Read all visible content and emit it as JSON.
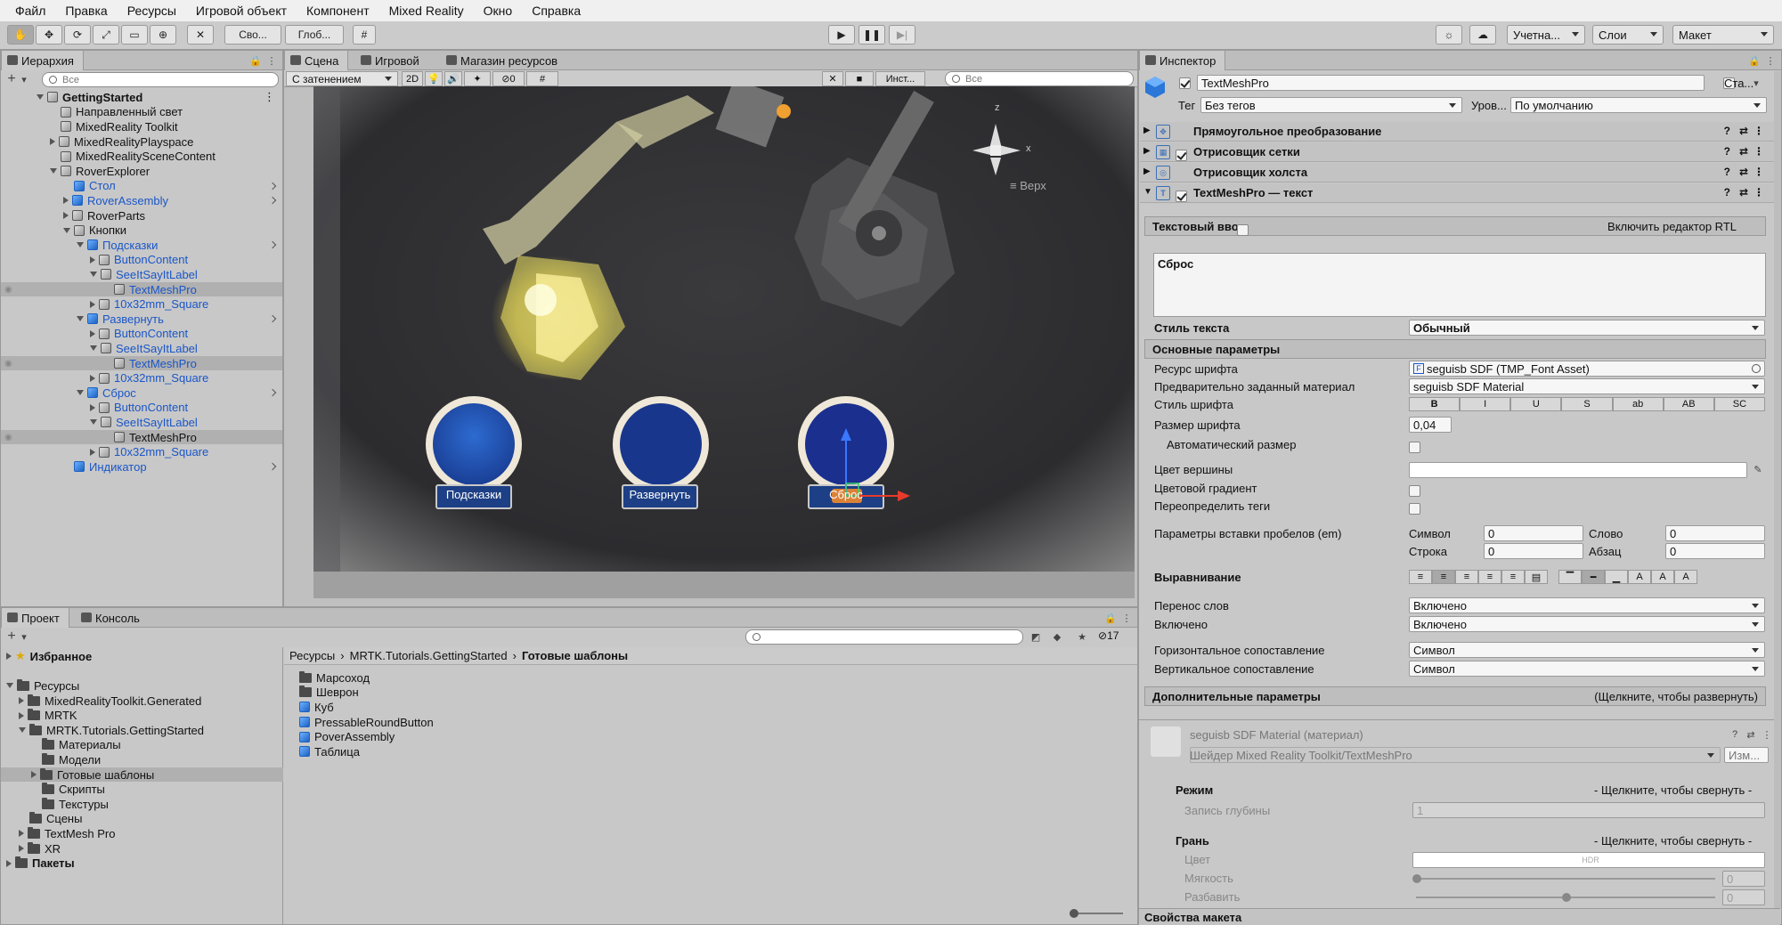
{
  "menu": [
    "Файл",
    "Правка",
    "Ресурсы",
    "Игровой объект",
    "Компонент",
    "Mixed Reality",
    "Окно",
    "Справка"
  ],
  "toolbar": {
    "pivot_label": "Сво...",
    "global_label": "Глоб...",
    "account_label": "Учетна...",
    "layers_label": "Слои",
    "layout_label": "Макет"
  },
  "hierarchy": {
    "tab": "Иерархия",
    "search_placeholder": "Все",
    "rows": [
      {
        "label": "GettingStarted",
        "indent": 0,
        "fold": "open",
        "icon": "unity",
        "bold": true,
        "sel": false,
        "blue": false,
        "chev": false
      },
      {
        "label": "Направленный свет",
        "indent": 1,
        "fold": "none",
        "icon": "cube",
        "sel": false,
        "blue": false,
        "chev": false
      },
      {
        "label": "MixedReality Toolkit",
        "indent": 1,
        "fold": "none",
        "icon": "cube",
        "sel": false,
        "blue": false,
        "chev": false
      },
      {
        "label": "MixedRealityPlayspace",
        "indent": 1,
        "fold": "closed",
        "icon": "cube",
        "sel": false,
        "blue": false,
        "chev": false
      },
      {
        "label": "MixedRealitySceneContent",
        "indent": 1,
        "fold": "none",
        "icon": "cube",
        "sel": false,
        "blue": false,
        "chev": false
      },
      {
        "label": "RoverExplorer",
        "indent": 1,
        "fold": "open",
        "icon": "cube",
        "sel": false,
        "blue": false,
        "chev": false
      },
      {
        "label": "Стол",
        "indent": 2,
        "fold": "none",
        "icon": "bluecube",
        "sel": false,
        "blue": true,
        "chev": true
      },
      {
        "label": "RoverAssembly",
        "indent": 2,
        "fold": "closed",
        "icon": "bluecube",
        "sel": false,
        "blue": true,
        "chev": true
      },
      {
        "label": "RoverParts",
        "indent": 2,
        "fold": "closed",
        "icon": "cube",
        "sel": false,
        "blue": false,
        "chev": false
      },
      {
        "label": "Кнопки",
        "indent": 2,
        "fold": "open",
        "icon": "cube",
        "sel": false,
        "blue": false,
        "chev": false
      },
      {
        "label": "Подсказки",
        "indent": 3,
        "fold": "open",
        "icon": "bluecube",
        "sel": false,
        "blue": true,
        "chev": true
      },
      {
        "label": "ButtonContent",
        "indent": 4,
        "fold": "closed",
        "icon": "cube",
        "sel": false,
        "blue": true,
        "chev": false
      },
      {
        "label": "SeeItSayItLabel",
        "indent": 4,
        "fold": "open",
        "icon": "cube",
        "sel": false,
        "blue": true,
        "chev": false
      },
      {
        "label": "TextMeshPro",
        "indent": 5,
        "fold": "none",
        "icon": "cube",
        "sel": true,
        "blue": true,
        "chev": false
      },
      {
        "label": "10x32mm_Square",
        "indent": 4,
        "fold": "closed",
        "icon": "cube",
        "sel": false,
        "blue": true,
        "chev": false
      },
      {
        "label": "Развернуть",
        "indent": 3,
        "fold": "open",
        "icon": "bluecube",
        "sel": false,
        "blue": true,
        "chev": true
      },
      {
        "label": "ButtonContent",
        "indent": 4,
        "fold": "closed",
        "icon": "cube",
        "sel": false,
        "blue": true,
        "chev": false
      },
      {
        "label": "SeeItSayItLabel",
        "indent": 4,
        "fold": "open",
        "icon": "cube",
        "sel": false,
        "blue": true,
        "chev": false
      },
      {
        "label": "TextMeshPro",
        "indent": 5,
        "fold": "none",
        "icon": "cube",
        "sel": true,
        "blue": true,
        "chev": false
      },
      {
        "label": "10x32mm_Square",
        "indent": 4,
        "fold": "closed",
        "icon": "cube",
        "sel": false,
        "blue": true,
        "chev": false
      },
      {
        "label": "Сброс",
        "indent": 3,
        "fold": "open",
        "icon": "bluecube",
        "sel": false,
        "blue": true,
        "chev": true
      },
      {
        "label": "ButtonContent",
        "indent": 4,
        "fold": "closed",
        "icon": "cube",
        "sel": false,
        "blue": true,
        "chev": false
      },
      {
        "label": "SeeItSayItLabel",
        "indent": 4,
        "fold": "open",
        "icon": "cube",
        "sel": false,
        "blue": true,
        "chev": false
      },
      {
        "label": "TextMeshPro",
        "indent": 5,
        "fold": "none",
        "icon": "cube",
        "sel": true,
        "blue": false,
        "chev": false
      },
      {
        "label": "10x32mm_Square",
        "indent": 4,
        "fold": "closed",
        "icon": "cube",
        "sel": false,
        "blue": true,
        "chev": false
      },
      {
        "label": "Индикатор",
        "indent": 2,
        "fold": "none",
        "icon": "bluecube",
        "sel": false,
        "blue": true,
        "chev": true
      }
    ]
  },
  "scene": {
    "tabs": [
      "Сцена",
      "Игровой",
      "Магазин ресурсов"
    ],
    "shading": "С затенением",
    "mode2d": "2D",
    "gizmo_count": "0",
    "gizmos_label": "Инст...",
    "search_placeholder": "Все",
    "top_label": "Верх",
    "axis_y": "z",
    "axis_x": "x",
    "buttons": [
      "Подсказки",
      "Развернуть",
      "Сброс"
    ]
  },
  "project": {
    "tabs": [
      "Проект",
      "Консоль"
    ],
    "hidden_count": "17",
    "tree": [
      {
        "label": "Избранное",
        "indent": 0,
        "fold": "closed",
        "icon": "star",
        "bold": true,
        "sel": false
      },
      {
        "label": "",
        "indent": 0,
        "fold": "none",
        "icon": "none",
        "bold": false,
        "sel": false
      },
      {
        "label": "Ресурсы",
        "indent": 0,
        "fold": "open",
        "icon": "folder",
        "bold": false,
        "sel": false
      },
      {
        "label": "MixedRealityToolkit.Generated",
        "indent": 1,
        "fold": "closed",
        "icon": "folder",
        "bold": false,
        "sel": false
      },
      {
        "label": "MRTK",
        "indent": 1,
        "fold": "closed",
        "icon": "folder",
        "bold": false,
        "sel": false
      },
      {
        "label": "MRTK.Tutorials.GettingStarted",
        "indent": 1,
        "fold": "open",
        "icon": "folder",
        "bold": false,
        "sel": false
      },
      {
        "label": "Материалы",
        "indent": 2,
        "fold": "none",
        "icon": "folder",
        "bold": false,
        "sel": false
      },
      {
        "label": "Модели",
        "indent": 2,
        "fold": "none",
        "icon": "folder",
        "bold": false,
        "sel": false
      },
      {
        "label": "Готовые шаблоны",
        "indent": 2,
        "fold": "closed",
        "icon": "folder",
        "bold": false,
        "sel": true
      },
      {
        "label": "Скрипты",
        "indent": 2,
        "fold": "none",
        "icon": "folder",
        "bold": false,
        "sel": false
      },
      {
        "label": "Текстуры",
        "indent": 2,
        "fold": "none",
        "icon": "folder",
        "bold": false,
        "sel": false
      },
      {
        "label": "Сцены",
        "indent": 1,
        "fold": "none",
        "icon": "folder",
        "bold": false,
        "sel": false
      },
      {
        "label": "TextMesh Pro",
        "indent": 1,
        "fold": "closed",
        "icon": "folder",
        "bold": false,
        "sel": false
      },
      {
        "label": "XR",
        "indent": 1,
        "fold": "closed",
        "icon": "folder",
        "bold": false,
        "sel": false
      },
      {
        "label": "Пакеты",
        "indent": 0,
        "fold": "closed",
        "icon": "folder",
        "bold": true,
        "sel": false
      }
    ],
    "breadcrumb": [
      "Ресурсы",
      "MRTK.Tutorials.GettingStarted",
      "Готовые шаблоны"
    ],
    "assets": [
      {
        "label": "Марсоход",
        "icon": "folder"
      },
      {
        "label": "Шеврон",
        "icon": "folder"
      },
      {
        "label": "Куб",
        "icon": "prefab"
      },
      {
        "label": "PressableRoundButton",
        "icon": "prefab"
      },
      {
        "label": "PoverAssembly",
        "icon": "prefab"
      },
      {
        "label": "Таблица",
        "icon": "prefab"
      }
    ]
  },
  "inspector": {
    "tab": "Инспектор",
    "object_name": "TextMeshPro",
    "static_label": "Ста...",
    "tag_label": "Тег",
    "tag_value": "Без тегов",
    "layer_label": "Уров...",
    "layer_value": "По умолчанию",
    "components": [
      {
        "label": "Прямоугольное преобразование",
        "check": false
      },
      {
        "label": "Отрисовщик сетки",
        "check": true
      },
      {
        "label": "Отрисовщик холста",
        "check": false
      },
      {
        "label": "TextMeshPro — текст",
        "check": true
      }
    ],
    "text_input_header": "Текстовый ввод",
    "rtl_label": "Включить редактор RTL",
    "text_value": "Сброс",
    "text_style_label": "Стиль текста",
    "text_style_value": "Обычный",
    "main_settings": "Основные параметры",
    "font_asset_label": "Ресурс шрифта",
    "font_asset_value": "seguisb SDF (TMP_Font Asset)",
    "material_preset_label": "Предварительно заданный материал",
    "material_preset_value": "seguisb SDF Material",
    "font_style_label": "Стиль шрифта",
    "font_style_buttons": [
      "B",
      "I",
      "U",
      "S",
      "ab",
      "AB",
      "SC"
    ],
    "font_size_label": "Размер шрифта",
    "font_size_value": "0,04",
    "auto_size_label": "Автоматический размер",
    "vertex_color_label": "Цвет вершины",
    "color_gradient_label": "Цветовой градиент",
    "override_tags_label": "Переопределить теги",
    "spacing_label": "Параметры вставки пробелов (em)",
    "spacing": [
      {
        "label": "Символ",
        "value": "0"
      },
      {
        "label": "Слово",
        "value": "0"
      },
      {
        "label": "Строка",
        "value": "0"
      },
      {
        "label": "Абзац",
        "value": "0"
      }
    ],
    "alignment_label": "Выравнивание",
    "wrapping_label": "Перенос слов",
    "wrapping_value": "Включено",
    "overflow_label": "Включено",
    "overflow_value": "Включено",
    "hmapping_label": "Горизонтальное сопоставление",
    "hmapping_value": "Символ",
    "vmapping_label": "Вертикальное сопоставление",
    "vmapping_value": "Символ",
    "extra_settings": "Дополнительные параметры",
    "extra_hint": "(Щелкните, чтобы развернуть)",
    "material_name": "seguisb SDF Material (материал)",
    "shader_label": "Шейдер Mixed Reality Toolkit/TextMeshPro",
    "shader_btn": "Изм...",
    "mode_label": "Режим",
    "collapse_hint": "- Щелкните, чтобы свернуть -",
    "depth_label": "Запись глубины",
    "depth_value": "1",
    "face_label": "Грань",
    "face_color_label": "Цвет",
    "hdr_label": "HDR",
    "softness_label": "Мягкость",
    "softness_value": "0",
    "dilate_label": "Разбавить",
    "dilate_value": "0",
    "layout_props": "Свойства макета"
  },
  "colors": {
    "accent": "#1a56c8",
    "panel": "#c8c8c8",
    "scene_bg": "#2a2a2d",
    "button_blue": "#1f4fa8",
    "label_bg": "#1d3f85"
  }
}
